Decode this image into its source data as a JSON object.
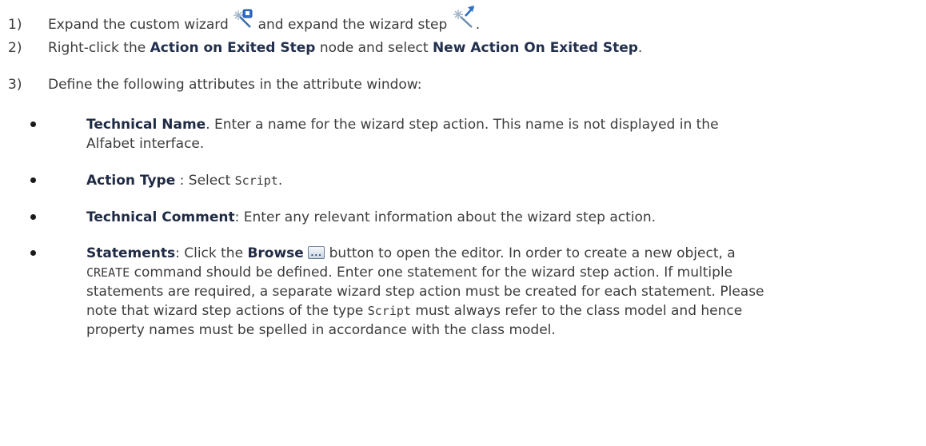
{
  "steps": [
    {
      "num": "1)",
      "t1": "Expand the custom wizard",
      "icon1": "custom-wizard-icon",
      "t2": "and expand the wizard step",
      "icon2": "wizard-step-icon",
      "t3": "."
    },
    {
      "num": "2)",
      "t1": "Right-click the",
      "b1": "Action on Exited Step",
      "t2": "node and select",
      "b2": "New Action On Exited Step",
      "t3": "."
    },
    {
      "num": "3)",
      "t1": "Define the following attributes in the attribute window:"
    }
  ],
  "bullets": {
    "technical_name": {
      "label": "Technical Name",
      "line1": ". Enter a name for the wizard step action. This name is not displayed in the",
      "line2": "Alfabet interface."
    },
    "action_type": {
      "label": "Action Type",
      "t1": " : Select ",
      "code": "Script",
      "t2": "."
    },
    "technical_comment": {
      "label": "Technical Comment",
      "t1": ": Enter any relevant information about the wizard step action."
    },
    "statements": {
      "label": "Statements",
      "t1": ": Click the ",
      "browse": "Browse",
      "browse_icon": "...",
      "t2": " button to open the editor. In order to create a new object, a",
      "code1": "CREATE",
      "l2": " command should be defined. Enter one statement for the wizard step action. If multiple",
      "l3": "statements are required, a separate wizard step action must be created for each statement. Please",
      "l4a": "note that wizard step actions of the type ",
      "code2": "Script",
      "l4b": " must always refer to the class model and hence",
      "l5": "property names must be spelled in accordance with the class model."
    }
  }
}
